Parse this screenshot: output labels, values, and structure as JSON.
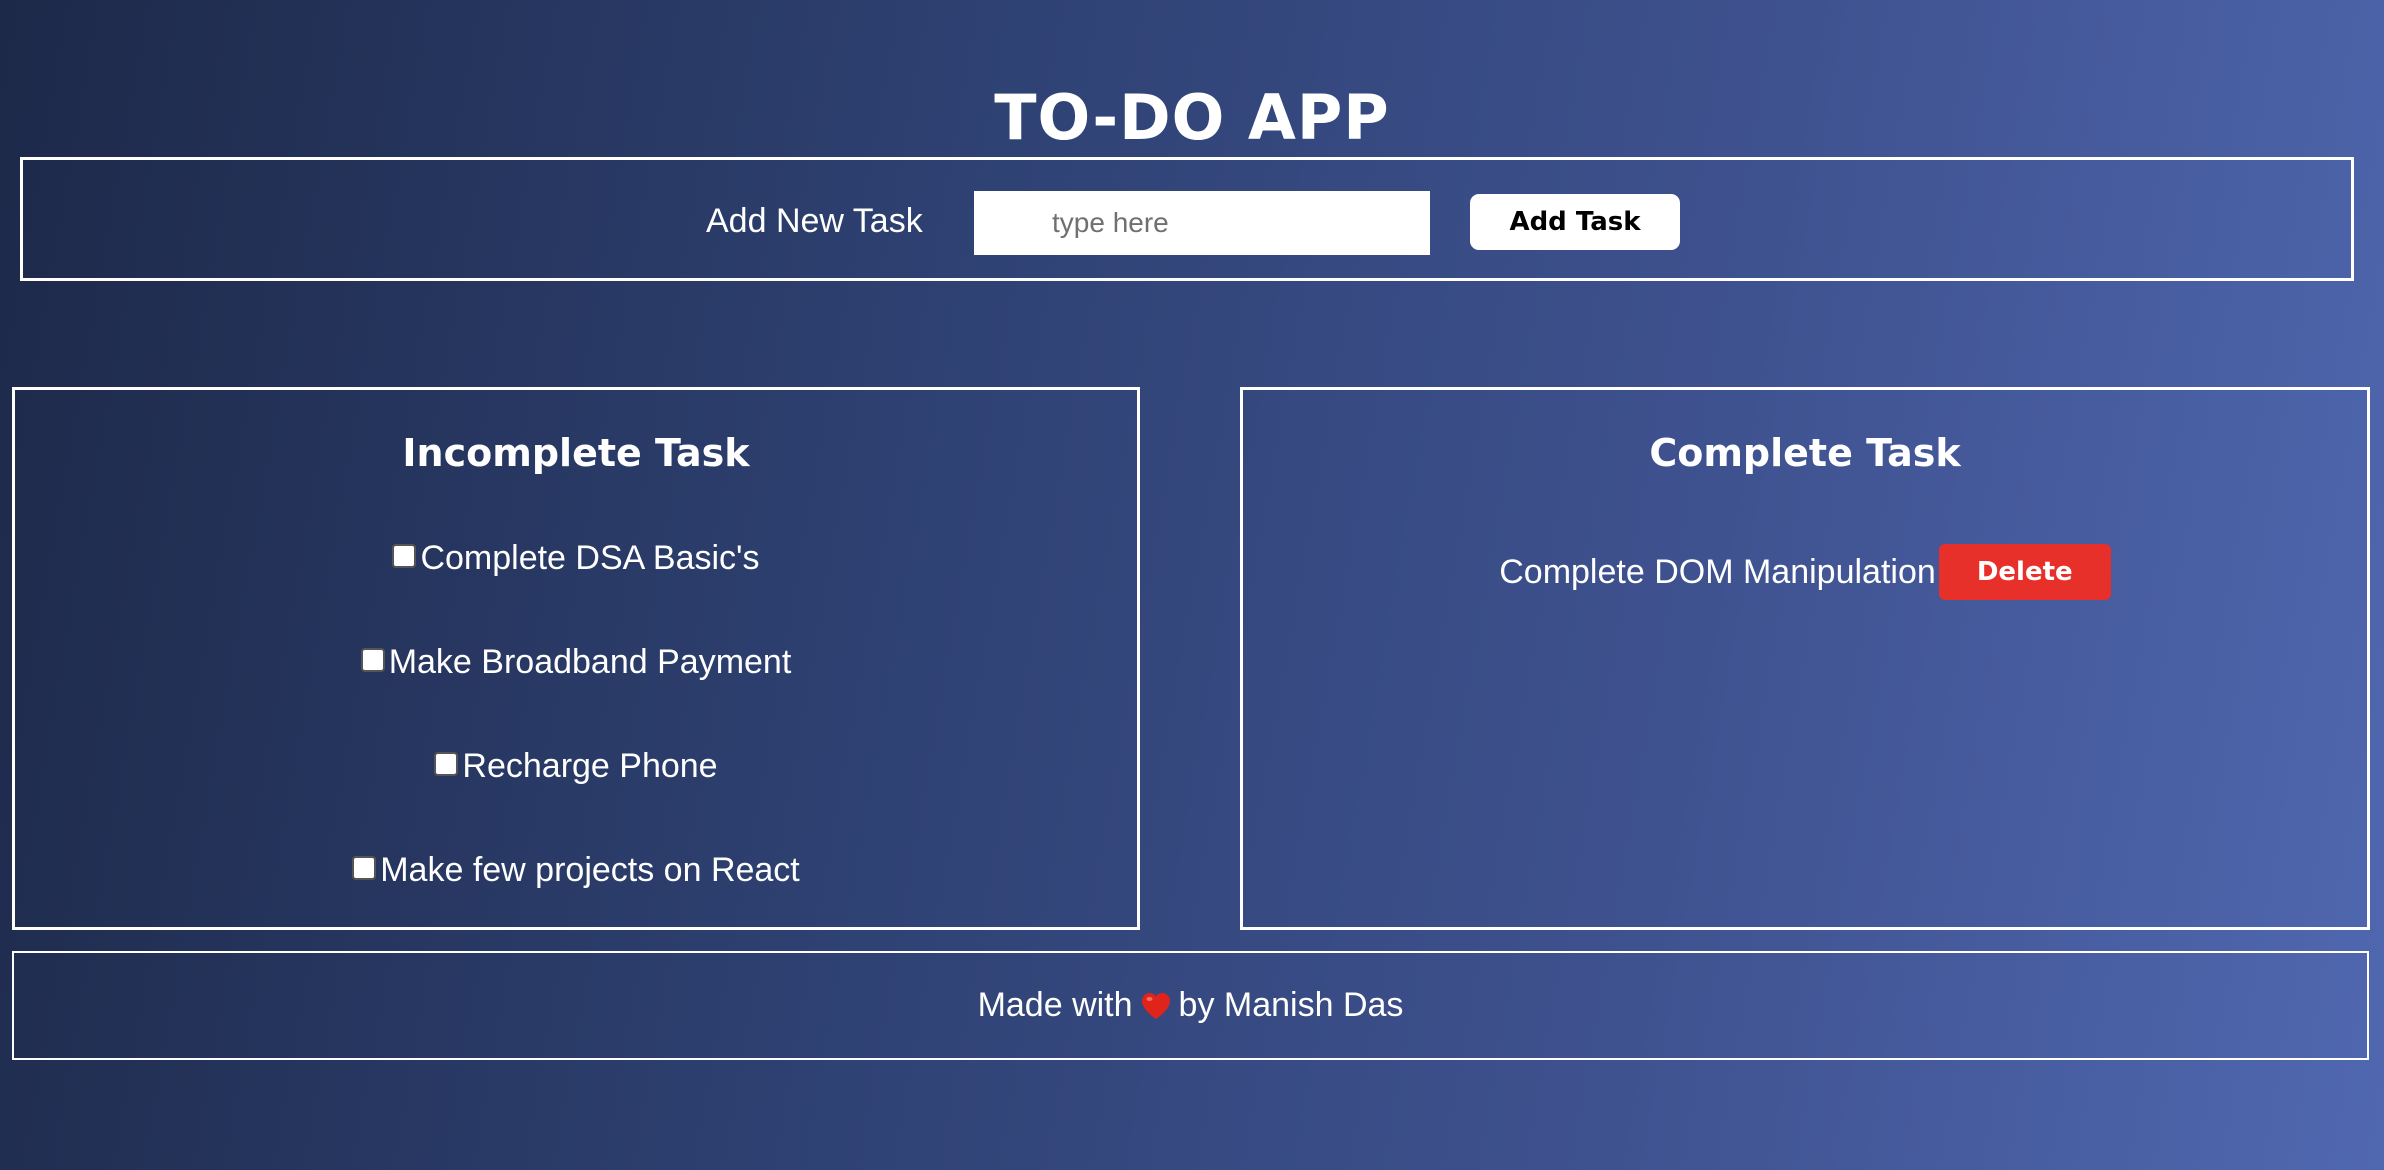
{
  "app": {
    "title": "TO-DO APP"
  },
  "add_task": {
    "label": "Add New Task",
    "input_value": "",
    "input_placeholder": "type here",
    "button_label": "Add Task"
  },
  "incomplete": {
    "title": "Incomplete Task",
    "items": [
      {
        "label": "Complete DSA Basic's",
        "checked": false
      },
      {
        "label": "Make Broadband Payment",
        "checked": false
      },
      {
        "label": "Recharge Phone",
        "checked": false
      },
      {
        "label": "Make few projects on React",
        "checked": false
      }
    ]
  },
  "complete": {
    "title": "Complete Task",
    "items": [
      {
        "label": "Complete DOM Manipulation",
        "delete_label": "Delete"
      }
    ]
  },
  "footer": {
    "prefix": "Made with",
    "heart_icon": "heart-icon",
    "suffix": "by Manish Das"
  },
  "colors": {
    "gradient_start": "#1d2949",
    "gradient_end": "#5068b0",
    "delete_button": "#e8302a",
    "heart": "#e0241b",
    "border": "#ffffff"
  }
}
